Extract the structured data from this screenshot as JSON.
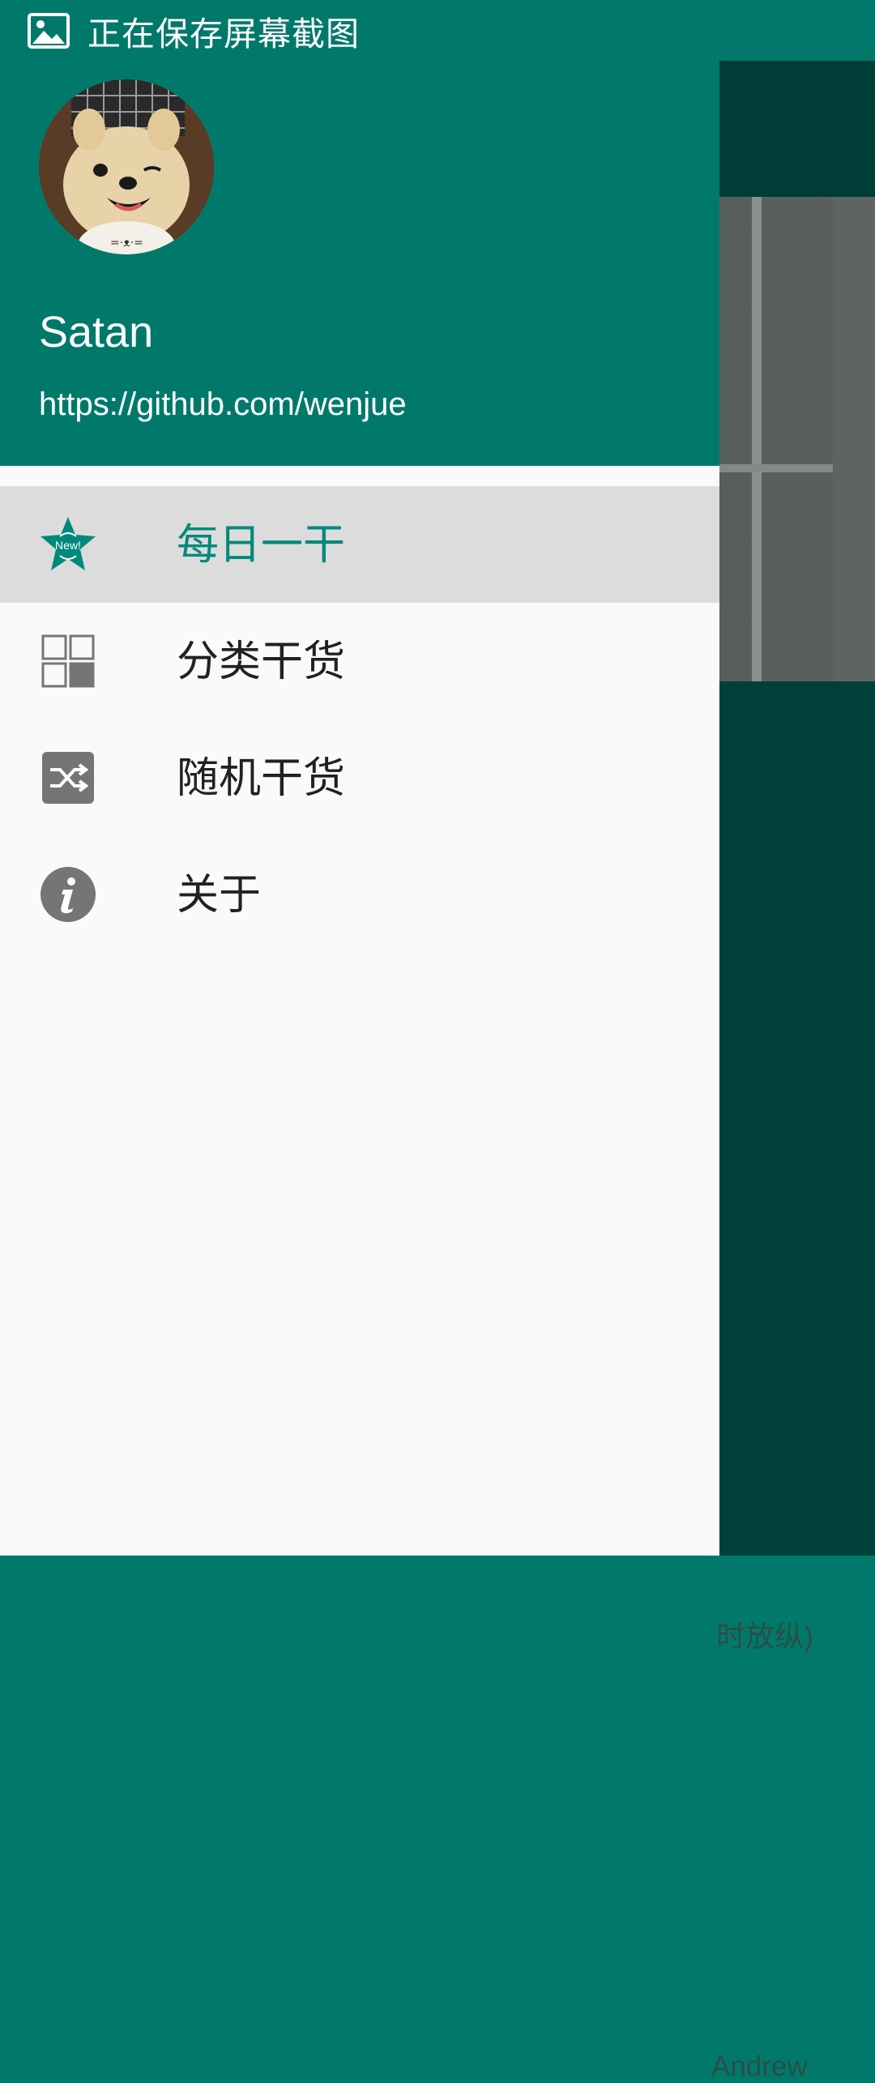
{
  "status_bar": {
    "icon": "image-icon",
    "text": "正在保存屏幕截图"
  },
  "drawer": {
    "header": {
      "user_name": "Satan",
      "user_url": "https://github.com/wenjue"
    },
    "menu_items": [
      {
        "label": "每日一干",
        "icon": "new-star-icon",
        "selected": true
      },
      {
        "label": "分类干货",
        "icon": "grid-icon",
        "selected": false
      },
      {
        "label": "随机干货",
        "icon": "shuffle-icon",
        "selected": false
      },
      {
        "label": "关于",
        "icon": "info-icon",
        "selected": false
      }
    ],
    "new_badge_text": "New!"
  },
  "background": {
    "text_fragment_1": "时放纵)",
    "text_fragment_2": "Andrew"
  },
  "colors": {
    "primary": "#00796B",
    "accent": "#00897B",
    "selected_bg": "#dcdcdc",
    "drawer_bg": "#fafafa",
    "scrim_content": "#00403a"
  }
}
